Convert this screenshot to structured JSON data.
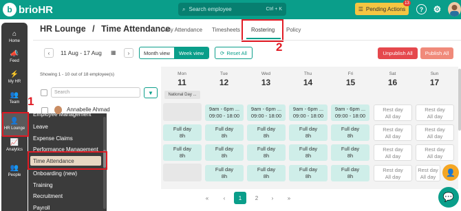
{
  "topbar": {
    "logo_text": "brioHR",
    "search_placeholder": "Search employee",
    "search_shortcut": "Ctrl + K",
    "pending_actions": "Pending Actions",
    "pending_count": "13",
    "help_icon": "?",
    "settings_icon": "⚙"
  },
  "sidebar": {
    "items": [
      {
        "label": "Home",
        "icon": "⌂"
      },
      {
        "label": "Feed",
        "icon": "📣"
      },
      {
        "label": "My HR",
        "icon": "⚡"
      },
      {
        "label": "Team",
        "icon": "👥"
      },
      {
        "label": "HR Lounge",
        "icon": "👤"
      },
      {
        "label": "Analytics",
        "icon": "📈"
      },
      {
        "label": "People",
        "icon": "👥"
      }
    ]
  },
  "submenu": {
    "items": [
      "Employee Management",
      "Leave",
      "Expense Claims",
      "Performance Management",
      "Time Attendance",
      "Onboarding (new)",
      "Training",
      "Recruitment",
      "Payroll"
    ],
    "active": "Time Attendance"
  },
  "annotations": {
    "one": "1",
    "two": "2"
  },
  "header": {
    "breadcrumb_root": "HR Lounge",
    "separator": "/",
    "breadcrumb_page": "Time Attendance",
    "tabs": [
      "Daily Attendance",
      "Timesheets",
      "Rostering",
      "Policy"
    ],
    "active_tab": "Rostering"
  },
  "toolbar": {
    "prev": "‹",
    "next": "›",
    "date_range": "11 Aug - 17 Aug",
    "month_view": "Month view",
    "week_view": "Week view",
    "reset_all": "Reset All",
    "unpublish_all": "Unpublish All",
    "publish_all": "Publish All"
  },
  "employee_panel": {
    "showing": "Showing 1 - 10 out of 18 employee(s)",
    "search_placeholder": "Search",
    "employee_name": "Annabelle Ahmad"
  },
  "days": [
    {
      "name": "Mon",
      "num": "11"
    },
    {
      "name": "Tue",
      "num": "12"
    },
    {
      "name": "Wed",
      "num": "13"
    },
    {
      "name": "Thu",
      "num": "14"
    },
    {
      "name": "Fri",
      "num": "15"
    },
    {
      "name": "Sat",
      "num": "16"
    },
    {
      "name": "Sun",
      "num": "17"
    }
  ],
  "holiday_label": "National Day ...",
  "shifts": {
    "time_line1": "9am - 6pm ...",
    "time_line2": "09:00 - 18:00",
    "full_day": "Full day",
    "hours": "8h",
    "rest_day": "Rest day",
    "all_day": "All day"
  },
  "pagination": {
    "first": "«",
    "prev": "‹",
    "page1": "1",
    "page2": "2",
    "next": "›",
    "last": "»"
  }
}
